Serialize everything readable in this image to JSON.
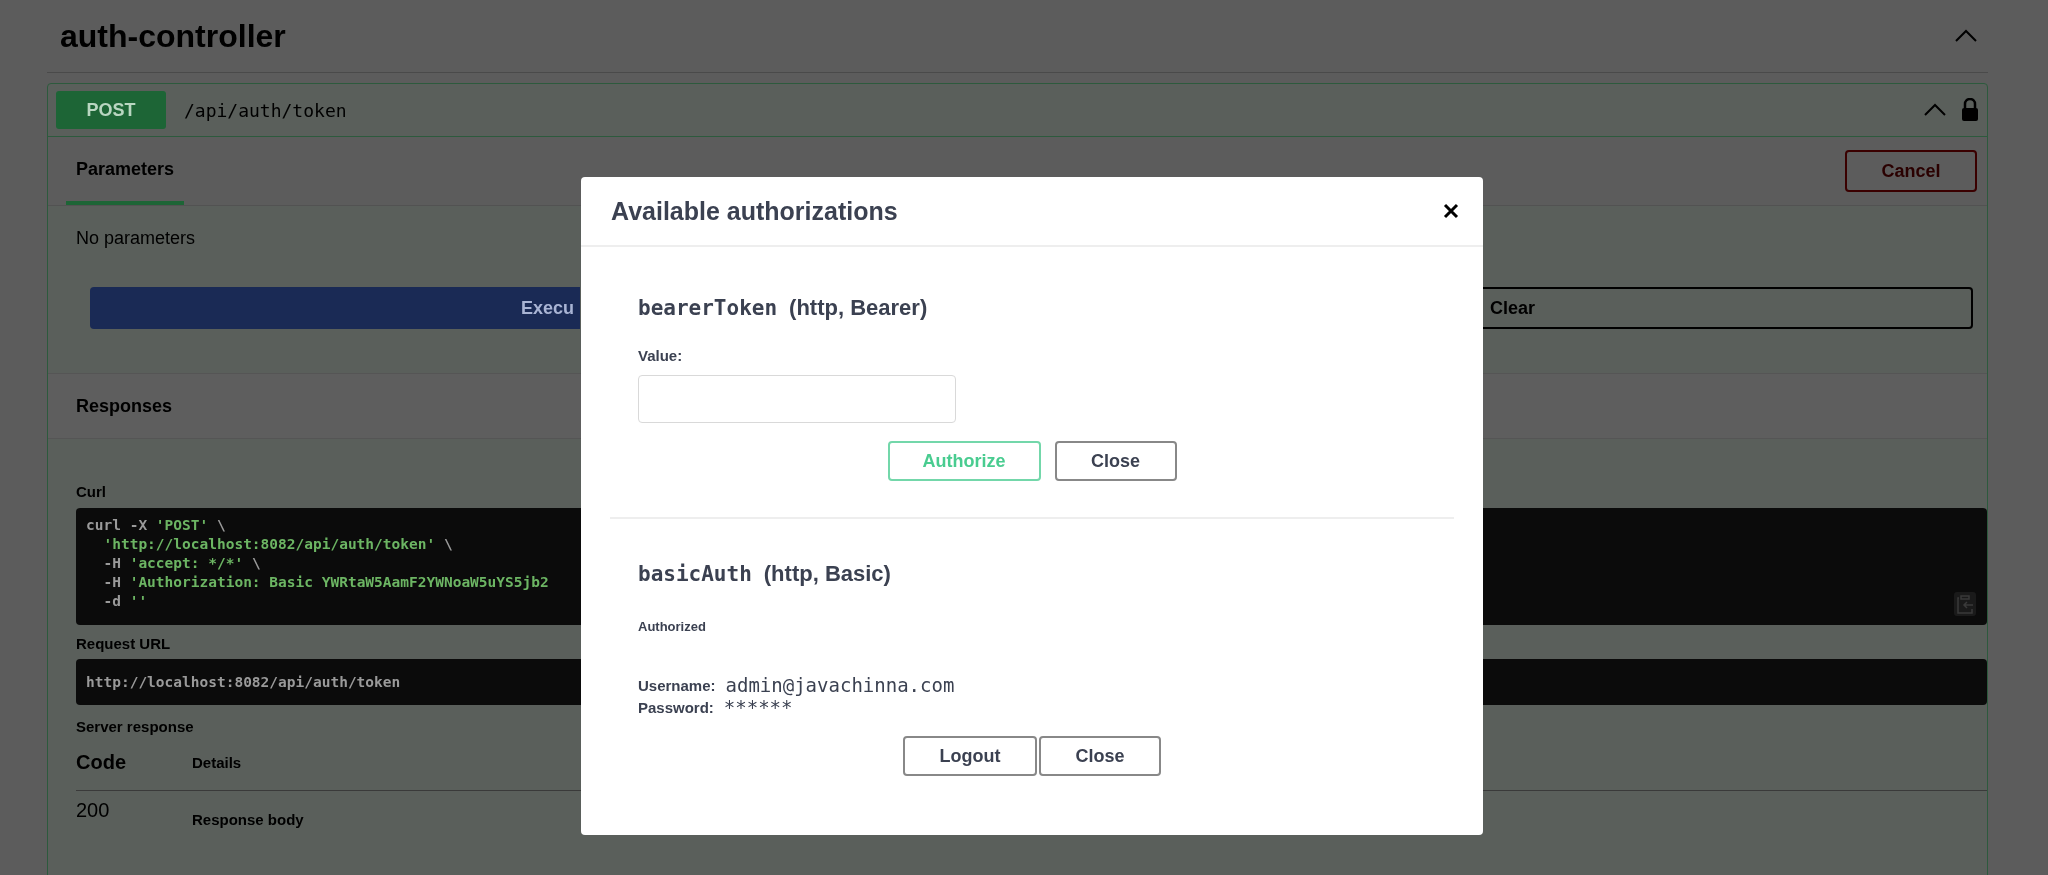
{
  "section": {
    "title": "auth-controller",
    "expanded": true
  },
  "operation": {
    "method": "POST",
    "path": "/api/auth/token",
    "expanded": true,
    "locked": true
  },
  "tabs": [
    {
      "label": "Parameters",
      "selected": true
    }
  ],
  "cancel_button": "Cancel",
  "parameters_text": "No parameters",
  "execute_button": "Execu",
  "clear_button": "Clear",
  "responses_title": "Responses",
  "curl": {
    "label": "Curl",
    "lines": [
      [
        {
          "kind": "code",
          "text": "curl -X "
        },
        {
          "kind": "string",
          "text": "'POST'"
        },
        {
          "kind": "code",
          "text": " \\"
        }
      ],
      [
        {
          "kind": "string",
          "text": "  'http://localhost:8082/api/auth/token'"
        },
        {
          "kind": "code",
          "text": " \\"
        }
      ],
      [
        {
          "kind": "code",
          "text": "  -H "
        },
        {
          "kind": "string",
          "text": "'accept: */*'"
        },
        {
          "kind": "code",
          "text": " \\"
        }
      ],
      [
        {
          "kind": "code",
          "text": "  -H "
        },
        {
          "kind": "string",
          "text": "'Authorization: Basic YWRtaW5AamF2YWNoaW5uYS5jb2"
        }
      ],
      [
        {
          "kind": "code",
          "text": "  -d "
        },
        {
          "kind": "string",
          "text": "''"
        }
      ]
    ]
  },
  "request_url": {
    "label": "Request URL",
    "value": "http://localhost:8082/api/auth/token"
  },
  "server_response": {
    "label": "Server response",
    "columns": [
      "Code",
      "Details"
    ],
    "rows": [
      {
        "code": "200",
        "details": "Response body"
      }
    ]
  },
  "modal": {
    "title": "Available authorizations",
    "schemes": [
      {
        "kind": "bearer",
        "name": "bearerToken",
        "type": "(http, Bearer)",
        "value_label": "Value:",
        "buttons": [
          {
            "label": "Authorize",
            "kind": "authorize"
          },
          {
            "label": "Close",
            "kind": "plain"
          }
        ]
      },
      {
        "kind": "basic",
        "name": "basicAuth",
        "type": "(http, Basic)",
        "status": "Authorized",
        "fields": [
          {
            "label": "Username:",
            "value": "admin@javachinna.com"
          },
          {
            "label": "Password:",
            "value": "******"
          }
        ],
        "buttons": [
          {
            "label": "Logout",
            "kind": "plain"
          },
          {
            "label": "Close",
            "kind": "plain"
          }
        ]
      }
    ]
  }
}
